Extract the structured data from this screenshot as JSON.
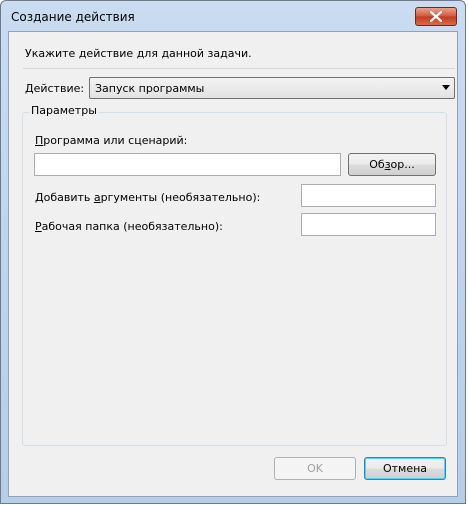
{
  "window": {
    "title": "Создание действия"
  },
  "instruction": "Укажите действие для данной задачи.",
  "action": {
    "label_pre": "",
    "label_accel": "Д",
    "label_post": "ействие:",
    "selected": "Запуск программы"
  },
  "parameters": {
    "title": "Параметры",
    "program": {
      "label_accel": "П",
      "label_post": "рограмма или сценарий:",
      "value": ""
    },
    "browse": {
      "pre": "Об",
      "accel": "з",
      "post": "ор..."
    },
    "arguments": {
      "pre": "Добавить ",
      "accel": "а",
      "post": "ргументы (необязательно):",
      "value": ""
    },
    "workdir": {
      "accel": "Р",
      "post": "абочая папка (необязательно):",
      "value": ""
    }
  },
  "buttons": {
    "ok": "OK",
    "cancel": "Отмена"
  }
}
